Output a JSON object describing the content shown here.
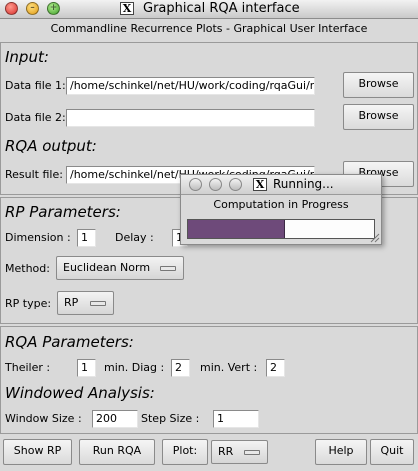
{
  "window": {
    "title": "Graphical RQA interface",
    "subtitle": "Commandline Recurrence Plots - Graphical User Interface",
    "minimize_glyph": "–",
    "zoom_glyph": "+",
    "x_glyph": "X"
  },
  "input": {
    "heading": "Input:",
    "file1_label": "Data file 1:",
    "file1_value": "/home/schinkel/net/HU/work/coding/rqaGui/ne",
    "file2_label": "Data file 2:",
    "file2_value": "",
    "browse_label": "Browse"
  },
  "rqa_output": {
    "heading": "RQA output:",
    "result_label": "Result file:",
    "result_value": "/home/schinkel/net/HU/work/coding/rqaGui/ne",
    "browse_label": "Browse"
  },
  "rp_parameters": {
    "heading": "RP Parameters:",
    "dimension_label": "Dimension :",
    "dimension_value": "1",
    "delay_label": "Delay :",
    "delay_value": "1",
    "method_label": "Method:",
    "method_value": "Euclidean Norm",
    "rptype_label": "RP type:",
    "rptype_value": "RP"
  },
  "rqa_parameters": {
    "heading": "RQA Parameters:",
    "theiler_label": "Theiler :",
    "theiler_value": "1",
    "mindiag_label": "min. Diag :",
    "mindiag_value": "2",
    "minvert_label": "min. Vert :",
    "minvert_value": "2"
  },
  "windowed": {
    "heading": "Windowed Analysis:",
    "window_size_label": "Window Size :",
    "window_size_value": "200",
    "step_size_label": "Step Size :",
    "step_size_value": "1"
  },
  "bottom_bar": {
    "show_rp_label": "Show RP",
    "run_rqa_label": "Run RQA",
    "plot_label": "Plot:",
    "plot_value": "RR",
    "help_label": "Help",
    "quit_label": "Quit"
  },
  "dialog": {
    "title": "Running...",
    "message": "Computation in Progress",
    "x_glyph": "X",
    "progress_fraction": 0.52,
    "progress_color": "#6e4a7a"
  }
}
